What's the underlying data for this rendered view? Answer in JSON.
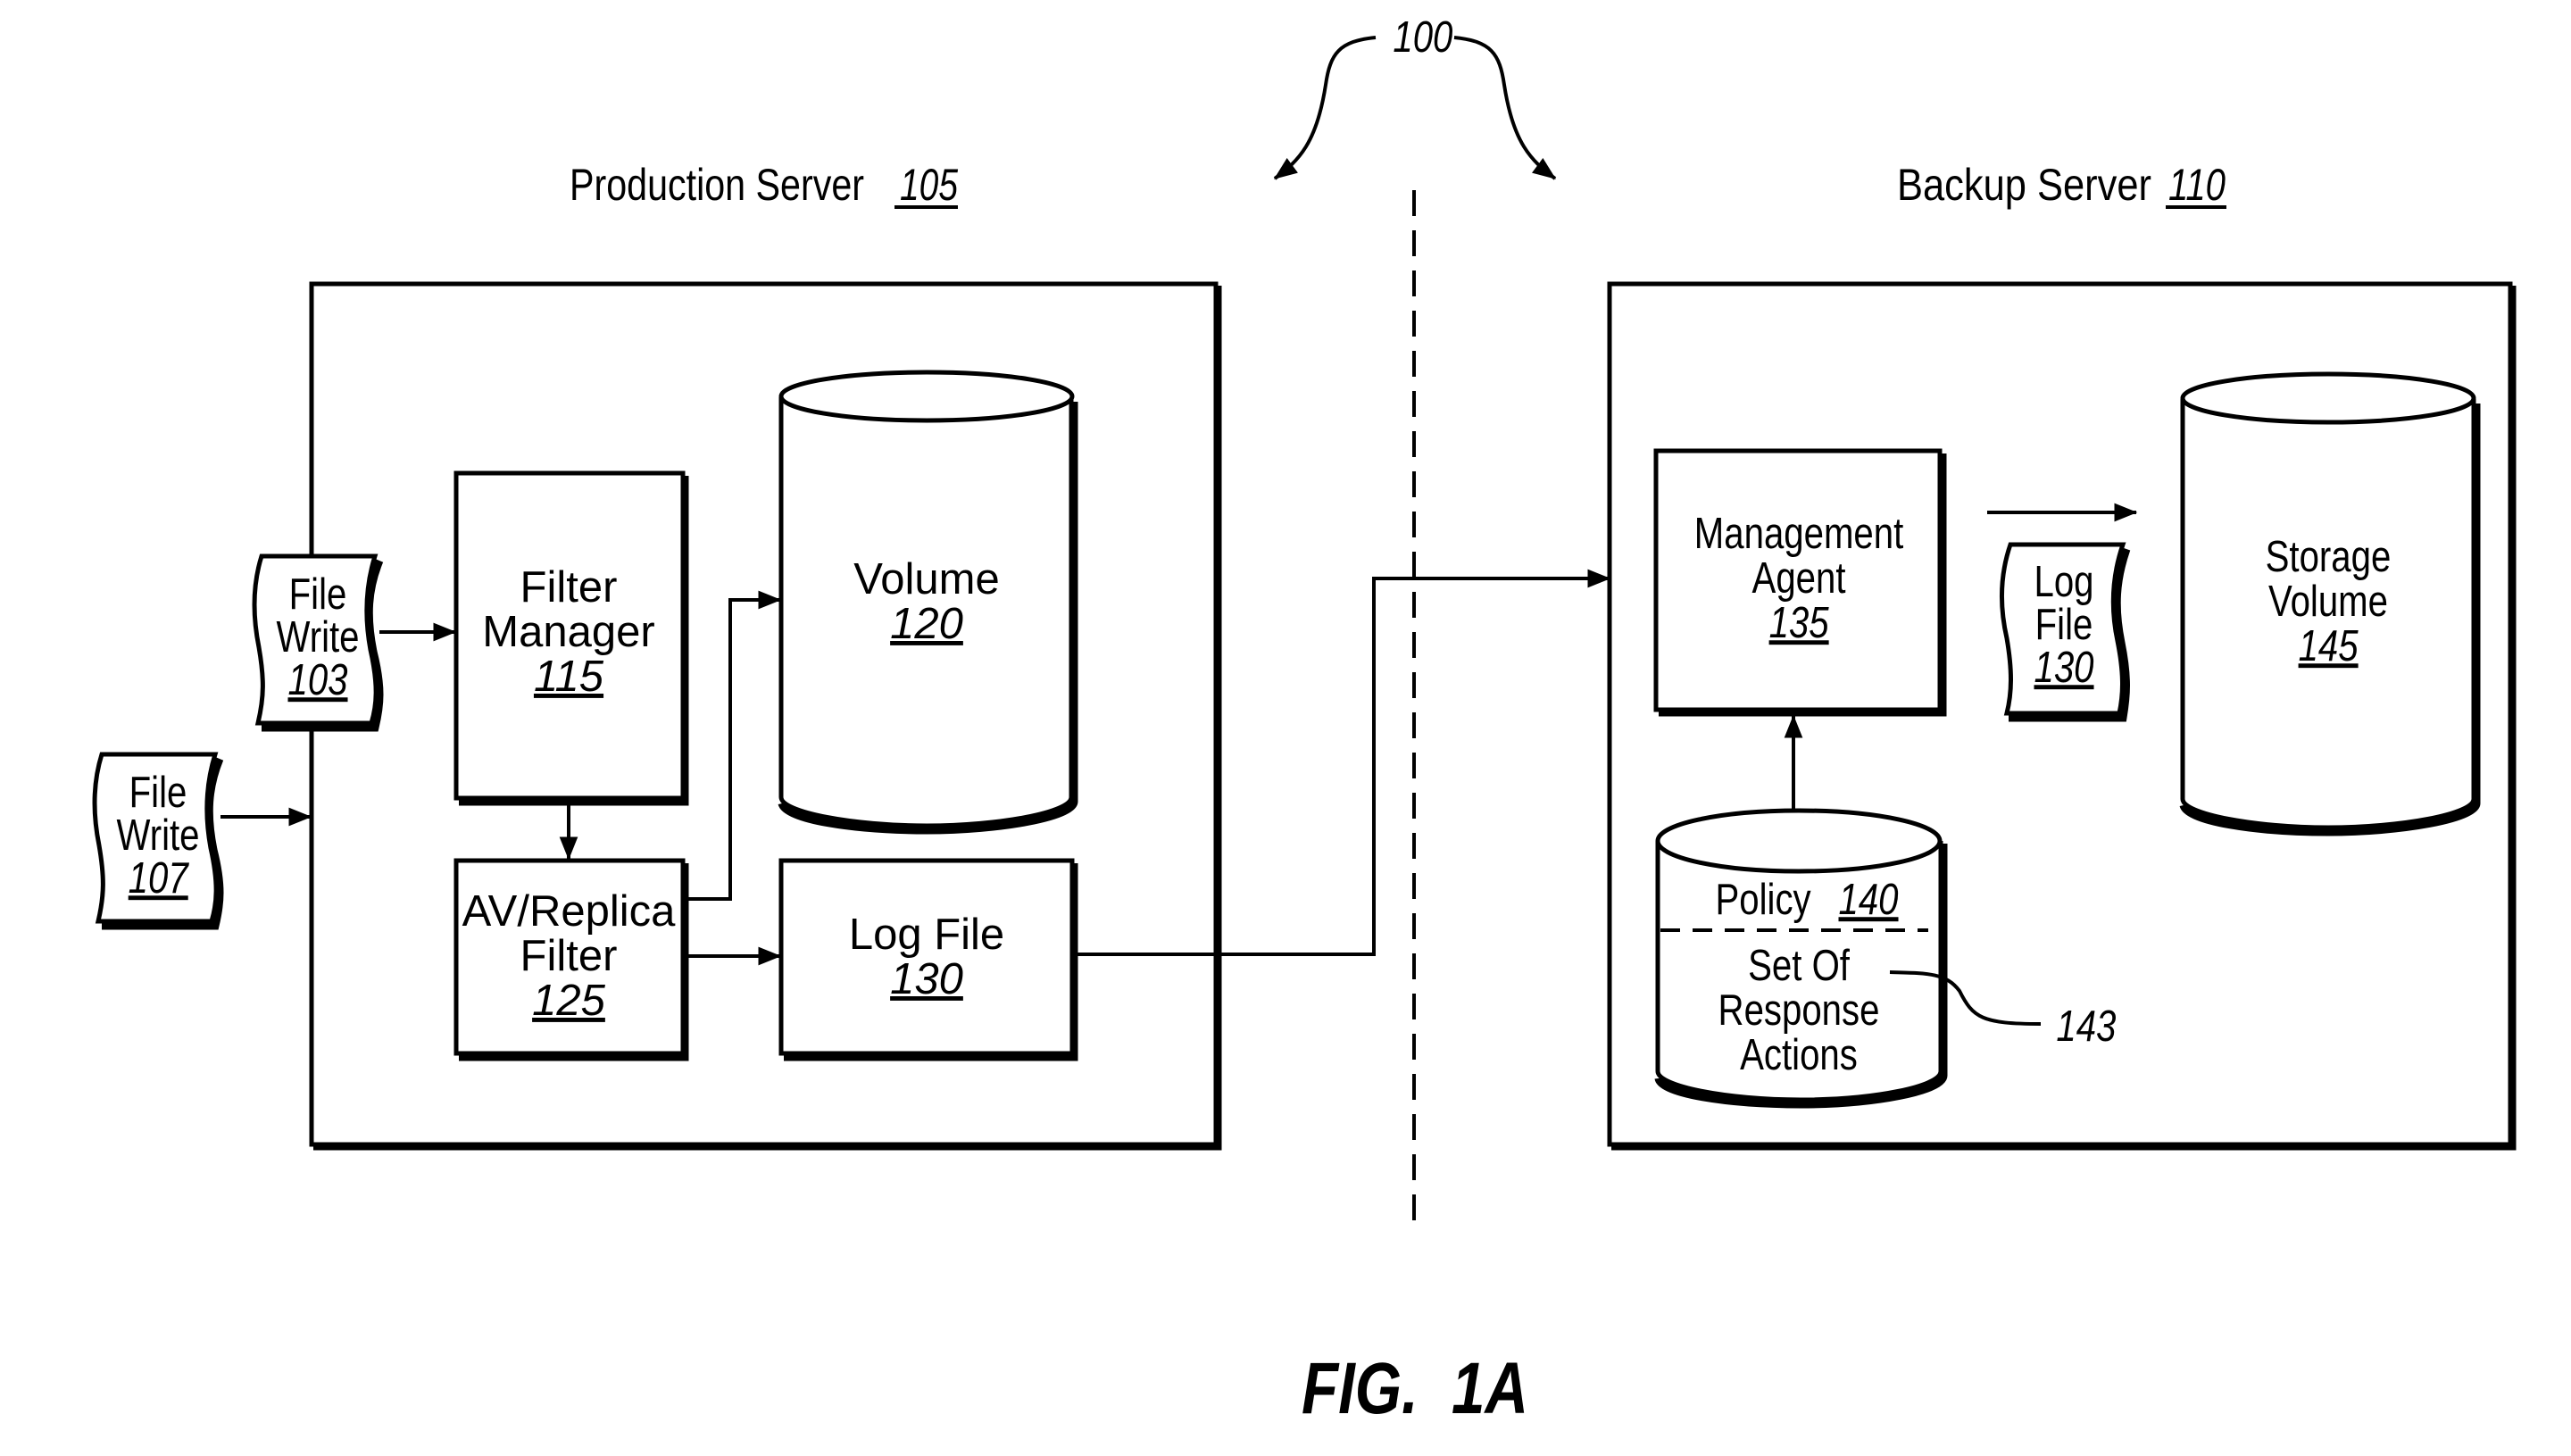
{
  "figure": {
    "reference_number": "100",
    "caption": "FIG.  1A"
  },
  "production_server": {
    "title": "Production Server",
    "ref": "105",
    "file_write_103": {
      "line1": "File",
      "line2": "Write",
      "ref": "103"
    },
    "file_write_107": {
      "line1": "File",
      "line2": "Write",
      "ref": "107"
    },
    "filter_manager": {
      "line1": "Filter",
      "line2": "Manager",
      "ref": "115"
    },
    "av_replica_filter": {
      "line1": "AV/Replica",
      "line2": "Filter",
      "ref": "125"
    },
    "volume": {
      "line1": "Volume",
      "ref": "120"
    },
    "log_file": {
      "line1": "Log File",
      "ref": "130"
    }
  },
  "backup_server": {
    "title": "Backup Server",
    "ref": "110",
    "management_agent": {
      "line1": "Management",
      "line2": "Agent",
      "ref": "135"
    },
    "log_file_doc": {
      "line1": "Log",
      "line2": "File",
      "ref": "130"
    },
    "storage_volume": {
      "line1": "Storage",
      "line2": "Volume",
      "ref": "145"
    },
    "policy": {
      "label": "Policy",
      "ref": "140",
      "section_line1": "Set Of",
      "section_line2": "Response",
      "section_line3": "Actions",
      "section_ref": "143"
    }
  }
}
